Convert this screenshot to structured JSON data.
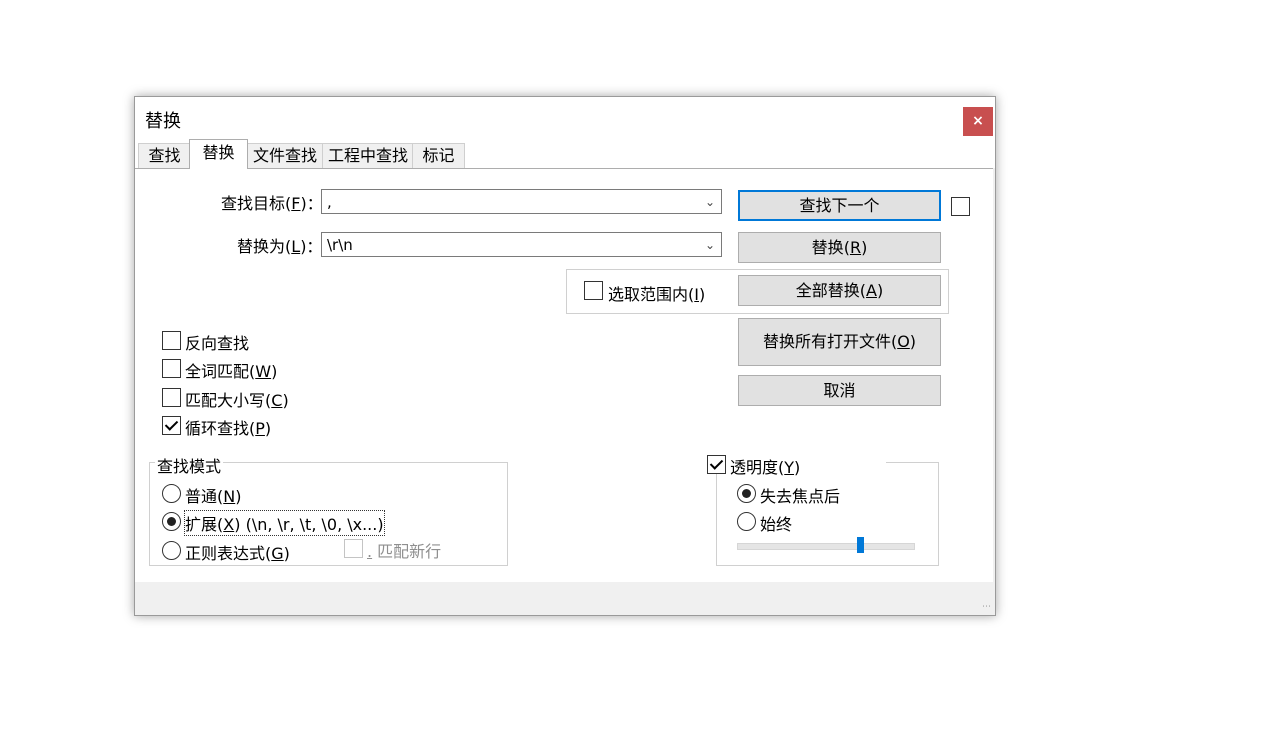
{
  "dialog": {
    "title": "替换",
    "close_glyph": "×"
  },
  "tabs": [
    {
      "label": "查找"
    },
    {
      "label": "替换"
    },
    {
      "label": "文件查找"
    },
    {
      "label": "工程中查找"
    },
    {
      "label": "标记"
    }
  ],
  "find": {
    "label": "查找目标",
    "mnemonic": "F",
    "suffix": ")：",
    "value": ","
  },
  "replace": {
    "label": "替换为",
    "mnemonic": "L",
    "suffix": ")：",
    "value": "\\r\\n"
  },
  "in_selection": {
    "label": "选取范围内",
    "mnemonic": "I",
    "checked": false
  },
  "buttons": {
    "find_next": {
      "label": "查找下一个"
    },
    "replace": {
      "label": "替换",
      "mnemonic": "R"
    },
    "replace_all": {
      "label": "全部替换",
      "mnemonic": "A"
    },
    "replace_all_open": {
      "label": "替换所有打开文件",
      "mnemonic": "O"
    },
    "cancel": {
      "label": "取消"
    }
  },
  "options": {
    "backward": {
      "label": "反向查找",
      "checked": false
    },
    "whole_word": {
      "label": "全词匹配",
      "mnemonic": "W",
      "checked": false
    },
    "match_case": {
      "label": "匹配大小写",
      "mnemonic": "C",
      "checked": false
    },
    "wrap_around": {
      "label": "循环查找",
      "mnemonic": "P",
      "checked": true
    }
  },
  "search_mode": {
    "title": "查找模式",
    "normal": {
      "label": "普通",
      "mnemonic": "N",
      "selected": false
    },
    "extended": {
      "label": "扩展",
      "mnemonic": "X",
      "rest": " (\\n, \\r, \\t, \\0, \\x...)",
      "selected": true
    },
    "regex": {
      "label": "正则表达式",
      "mnemonic": "G",
      "selected": false
    },
    "dot_newline": {
      "mnemonic": ".",
      "label": " 匹配新行",
      "checked": false,
      "enabled": false
    }
  },
  "transparency": {
    "label": "透明度",
    "mnemonic": "Y",
    "checked": true,
    "on_lose_focus": {
      "label": "失去焦点后",
      "selected": true
    },
    "always": {
      "label": "始终",
      "selected": false
    },
    "level": 0.7
  },
  "colors": {
    "close": "#c84f4f",
    "focus": "#0078d7",
    "slider": "#0078d7"
  }
}
